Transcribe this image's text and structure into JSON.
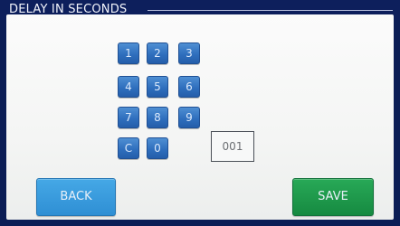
{
  "window": {
    "title": "DELAY IN SECONDS"
  },
  "keypad": {
    "keys": [
      "1",
      "2",
      "3",
      "4",
      "5",
      "6",
      "7",
      "8",
      "9",
      "C",
      "0"
    ]
  },
  "display": {
    "value": "001"
  },
  "buttons": {
    "back_label": "BACK",
    "save_label": "SAVE"
  },
  "colors": {
    "title_background": "#0b1d55",
    "keypad_key": "#2f6fbe",
    "back_button": "#2f8fd4",
    "save_button": "#168a41"
  }
}
